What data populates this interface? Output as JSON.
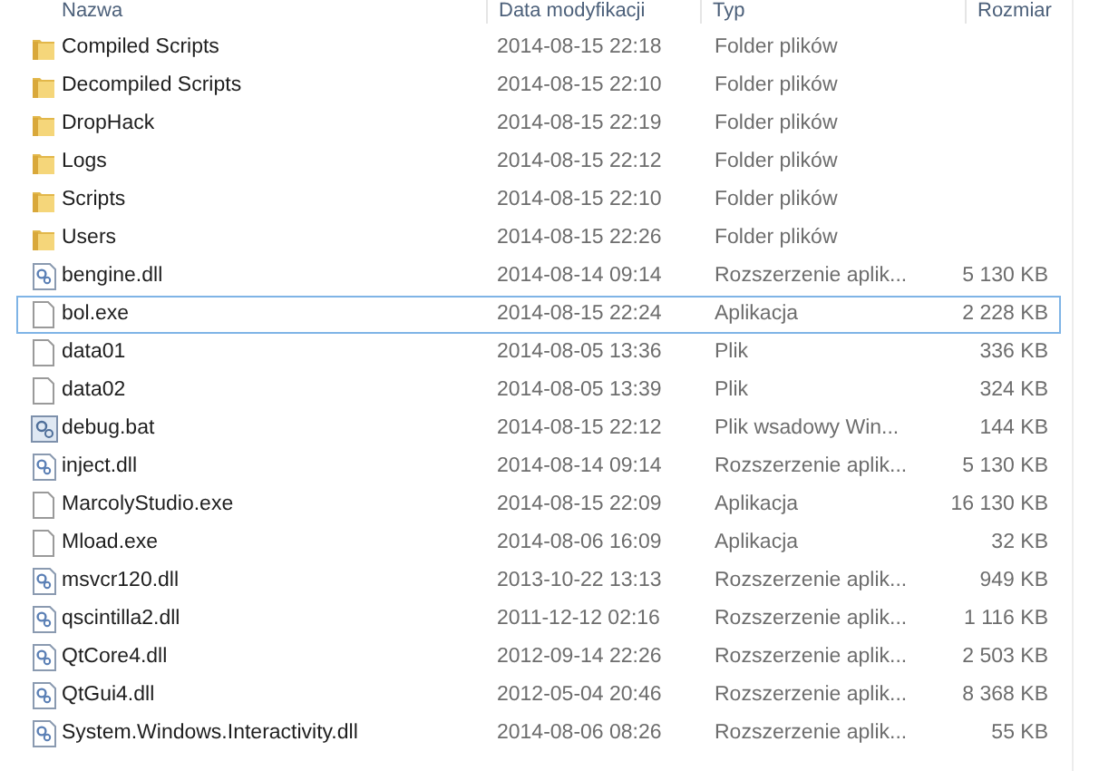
{
  "columns": [
    "Nazwa",
    "Data modyfikacji",
    "Typ",
    "Rozmiar"
  ],
  "rows": [
    {
      "kind": "folder",
      "name": "Compiled Scripts",
      "date": "2014-08-15 22:18",
      "type": "Folder plików",
      "selected": false
    },
    {
      "kind": "folder",
      "name": "Decompiled Scripts",
      "date": "2014-08-15 22:10",
      "type": "Folder plików",
      "selected": false
    },
    {
      "kind": "folder",
      "name": "DropHack",
      "date": "2014-08-15 22:19",
      "type": "Folder plików",
      "selected": false
    },
    {
      "kind": "folder",
      "name": "Logs",
      "date": "2014-08-15 22:12",
      "type": "Folder plików",
      "selected": false
    },
    {
      "kind": "folder",
      "name": "Scripts",
      "date": "2014-08-15 22:10",
      "type": "Folder plików",
      "selected": false
    },
    {
      "kind": "folder",
      "name": "Users",
      "date": "2014-08-15 22:26",
      "type": "Folder plików",
      "selected": false
    },
    {
      "kind": "dll",
      "name": "bengine.dll",
      "date": "2014-08-14 09:14",
      "type": "Rozszerzenie aplik...",
      "size": "5 130 KB",
      "selected": false
    },
    {
      "kind": "file",
      "name": "bol.exe",
      "date": "2014-08-15 22:24",
      "type": "Aplikacja",
      "size": "2 228 KB",
      "selected": true
    },
    {
      "kind": "file",
      "name": "data01",
      "date": "2014-08-05 13:36",
      "type": "Plik",
      "size": "336 KB",
      "selected": false
    },
    {
      "kind": "file",
      "name": "data02",
      "date": "2014-08-05 13:39",
      "type": "Plik",
      "size": "324 KB",
      "selected": false
    },
    {
      "kind": "bat",
      "name": "debug.bat",
      "date": "2014-08-15 22:12",
      "type": "Plik wsadowy Win...",
      "size": "144 KB",
      "selected": false
    },
    {
      "kind": "dll",
      "name": "inject.dll",
      "date": "2014-08-14 09:14",
      "type": "Rozszerzenie aplik...",
      "size": "5 130 KB",
      "selected": false
    },
    {
      "kind": "file",
      "name": "MarcolyStudio.exe",
      "date": "2014-08-15 22:09",
      "type": "Aplikacja",
      "size": "16 130 KB",
      "selected": false
    },
    {
      "kind": "file",
      "name": "Mload.exe",
      "date": "2014-08-06 16:09",
      "type": "Aplikacja",
      "size": "32 KB",
      "selected": false
    },
    {
      "kind": "dll",
      "name": "msvcr120.dll",
      "date": "2013-10-22 13:13",
      "type": "Rozszerzenie aplik...",
      "size": "949 KB",
      "selected": false
    },
    {
      "kind": "dll",
      "name": "qscintilla2.dll",
      "date": "2011-12-12 02:16",
      "type": "Rozszerzenie aplik...",
      "size": "1 116 KB",
      "selected": false
    },
    {
      "kind": "dll",
      "name": "QtCore4.dll",
      "date": "2012-09-14 22:26",
      "type": "Rozszerzenie aplik...",
      "size": "2 503 KB",
      "selected": false
    },
    {
      "kind": "dll",
      "name": "QtGui4.dll",
      "date": "2012-05-04 20:46",
      "type": "Rozszerzenie aplik...",
      "size": "8 368 KB",
      "selected": false
    },
    {
      "kind": "dll",
      "name": "System.Windows.Interactivity.dll",
      "date": "2014-08-06 08:26",
      "type": "Rozszerzenie aplik...",
      "size": "55 KB",
      "selected": false
    }
  ]
}
